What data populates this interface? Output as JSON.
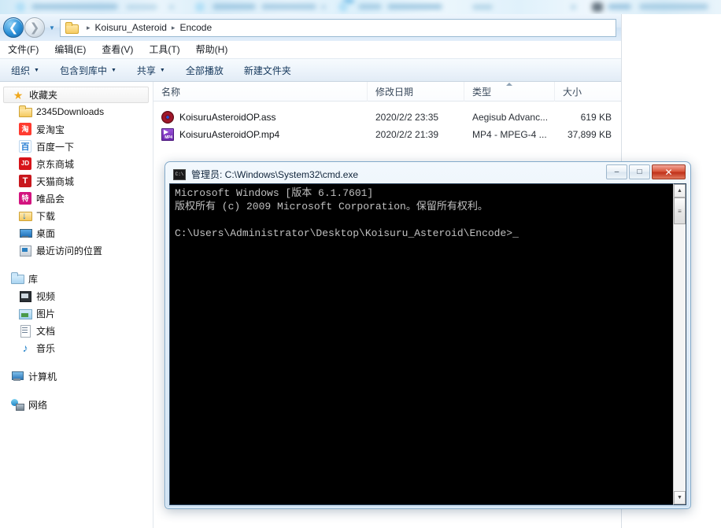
{
  "browser_strip": {
    "note": "blurred browser tab bar",
    "blurred": true
  },
  "explorer": {
    "address": {
      "back_icon": "back-arrow-icon",
      "forward_icon": "forward-arrow-icon",
      "history_icon": "chevron-down-icon",
      "folder_icon": "folder-icon",
      "crumbs": [
        "Koisuru_Asteroid",
        "Encode"
      ],
      "separator": "▸"
    },
    "menubar": [
      {
        "label": "文件(F)"
      },
      {
        "label": "编辑(E)"
      },
      {
        "label": "查看(V)"
      },
      {
        "label": "工具(T)"
      },
      {
        "label": "帮助(H)"
      }
    ],
    "toolbar": [
      {
        "label": "组织",
        "caret": "▼"
      },
      {
        "label": "包含到库中",
        "caret": "▼"
      },
      {
        "label": "共享",
        "caret": "▼"
      },
      {
        "label": "全部播放",
        "caret": ""
      },
      {
        "label": "新建文件夹",
        "caret": ""
      }
    ],
    "navpane": {
      "favorites": {
        "label": "收藏夹",
        "icon": "star-icon",
        "items": [
          {
            "label": "2345Downloads",
            "icon": "folder-icon"
          },
          {
            "label": "爱淘宝",
            "icon": "taobao-icon",
            "glyph": "淘"
          },
          {
            "label": "百度一下",
            "icon": "baidu-icon",
            "glyph": "百"
          },
          {
            "label": "京东商城",
            "icon": "jd-icon",
            "glyph": "JD"
          },
          {
            "label": "天猫商城",
            "icon": "tmall-icon",
            "glyph": "T"
          },
          {
            "label": "唯品会",
            "icon": "vip-icon",
            "glyph": "特"
          },
          {
            "label": "下载",
            "icon": "download-folder-icon"
          },
          {
            "label": "桌面",
            "icon": "desktop-icon"
          },
          {
            "label": "最近访问的位置",
            "icon": "recent-places-icon"
          }
        ]
      },
      "libraries": {
        "label": "库",
        "icon": "library-icon",
        "items": [
          {
            "label": "视频",
            "icon": "video-icon"
          },
          {
            "label": "图片",
            "icon": "pictures-icon"
          },
          {
            "label": "文档",
            "icon": "documents-icon"
          },
          {
            "label": "音乐",
            "icon": "music-icon",
            "glyph": "♪"
          }
        ]
      },
      "computer": {
        "label": "计算机",
        "icon": "computer-icon"
      },
      "network": {
        "label": "网络",
        "icon": "network-icon"
      }
    },
    "filelist": {
      "columns": [
        {
          "key": "name",
          "label": "名称",
          "sorted": false
        },
        {
          "key": "date",
          "label": "修改日期",
          "sorted": false
        },
        {
          "key": "type",
          "label": "类型",
          "sorted": true,
          "sort_dir": "asc"
        },
        {
          "key": "size",
          "label": "大小",
          "sorted": false
        }
      ],
      "rows": [
        {
          "name": "KoisuruAsteroidOP.ass",
          "date": "2020/2/2 23:35",
          "type": "Aegisub Advanc...",
          "size": "619 KB",
          "icon": "aegisub-subtitle-icon"
        },
        {
          "name": "KoisuruAsteroidOP.mp4",
          "date": "2020/2/2 21:39",
          "type": "MP4 - MPEG-4 ...",
          "size": "37,899 KB",
          "icon": "mp4-video-icon"
        }
      ]
    }
  },
  "cmd_window": {
    "title": "管理员: C:\\Windows\\System32\\cmd.exe",
    "title_icon_glyph": "C:\\",
    "controls": {
      "minimize": "–",
      "maximize": "□",
      "close": "✕"
    },
    "console_text": "Microsoft Windows [版本 6.1.7601]\n版权所有 (c) 2009 Microsoft Corporation。保留所有权利。\n\nC:\\Users\\Administrator\\Desktop\\Koisuru_Asteroid\\Encode>_",
    "scrollbar": {
      "up": "▲",
      "down": "▼",
      "thumb": "≡"
    }
  },
  "colors": {
    "accent_blue": "#2a7fc0",
    "title_gradient_top": "#f2f8fd",
    "console_bg": "#000000",
    "console_fg": "#c0c0c0",
    "close_red": "#c0311a",
    "folder_yellow": "#f5c95f"
  }
}
